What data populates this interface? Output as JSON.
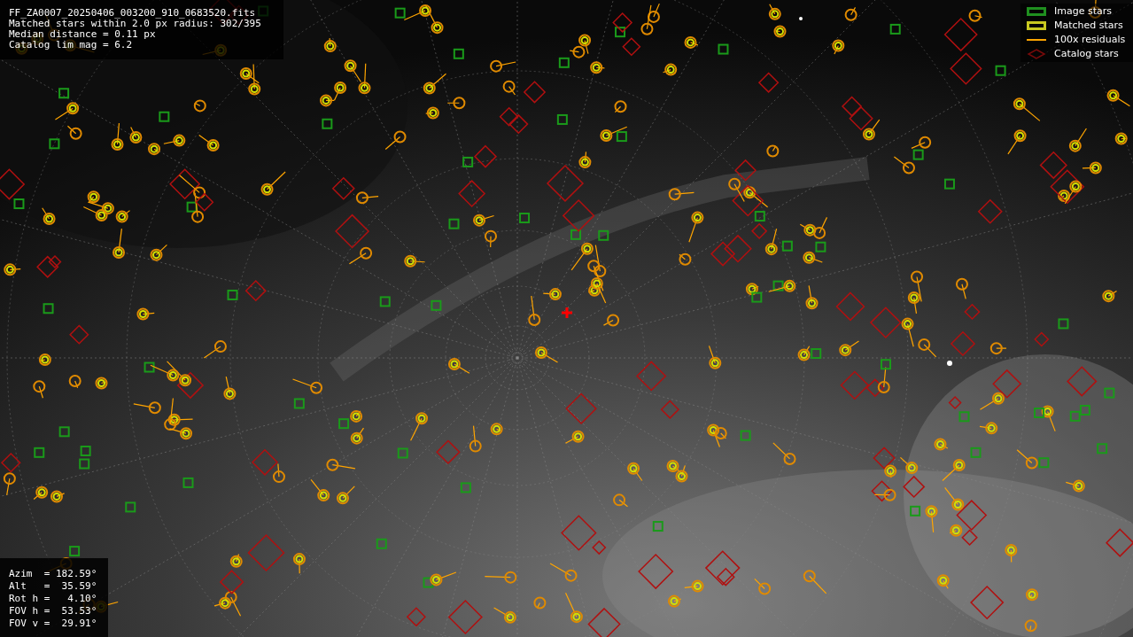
{
  "header": {
    "lines": [
      "FF_ZA0007_20250406_003200_910_0683520.fits",
      "Matched stars within 2.0 px radius: 302/395",
      "Median distance = 0.11 px",
      "Catalog lim mag = 6.2"
    ]
  },
  "legend": [
    {
      "label": "Image stars"
    },
    {
      "kind": "matched",
      "label": "Matched stars"
    },
    {
      "kind": "residual",
      "label": "100x residuals"
    },
    {
      "kind": "catalog",
      "label": "Catalog stars"
    }
  ],
  "pointing": {
    "lines": [
      "Azim  = 182.59°",
      "Alt   =  35.59°",
      "Rot h =   4.10°",
      "FOV h =  53.53°",
      "FOV v =  29.91°"
    ]
  }
}
